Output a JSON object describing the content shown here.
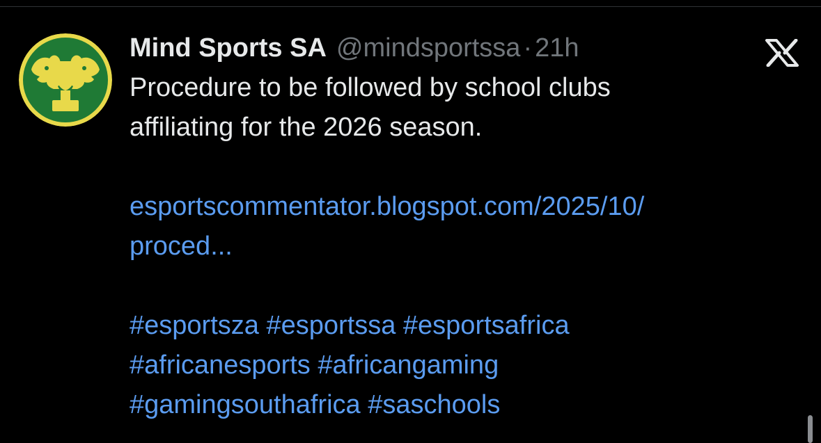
{
  "tweet": {
    "author": {
      "display_name": "Mind Sports SA",
      "handle": "@mindsportssa",
      "avatar_icon": "mind-sports-sa-logo",
      "avatar_colors": {
        "ring": "#e8d94a",
        "background": "#1f7a35",
        "figure": "#e8d94a"
      }
    },
    "separator": "·",
    "time": "21h",
    "platform_icon": "x-logo",
    "text": {
      "line1": "Procedure to be followed by school clubs",
      "line2": "affiliating for the 2026 season."
    },
    "link": {
      "line1": "esportscommentator.blogspot.com/2025/10/",
      "line2": "proced..."
    },
    "hashtags": {
      "line1": [
        "#esportsza",
        "#esportssa",
        "#esportsafrica"
      ],
      "line2": [
        "#africanesports",
        "#africangaming"
      ],
      "line3": [
        "#gamingsouthafrica",
        "#saschools"
      ]
    }
  },
  "colors": {
    "background": "#000000",
    "primary_text": "#e7e9ea",
    "secondary_text": "#71767b",
    "link": "#5b9cf0"
  }
}
